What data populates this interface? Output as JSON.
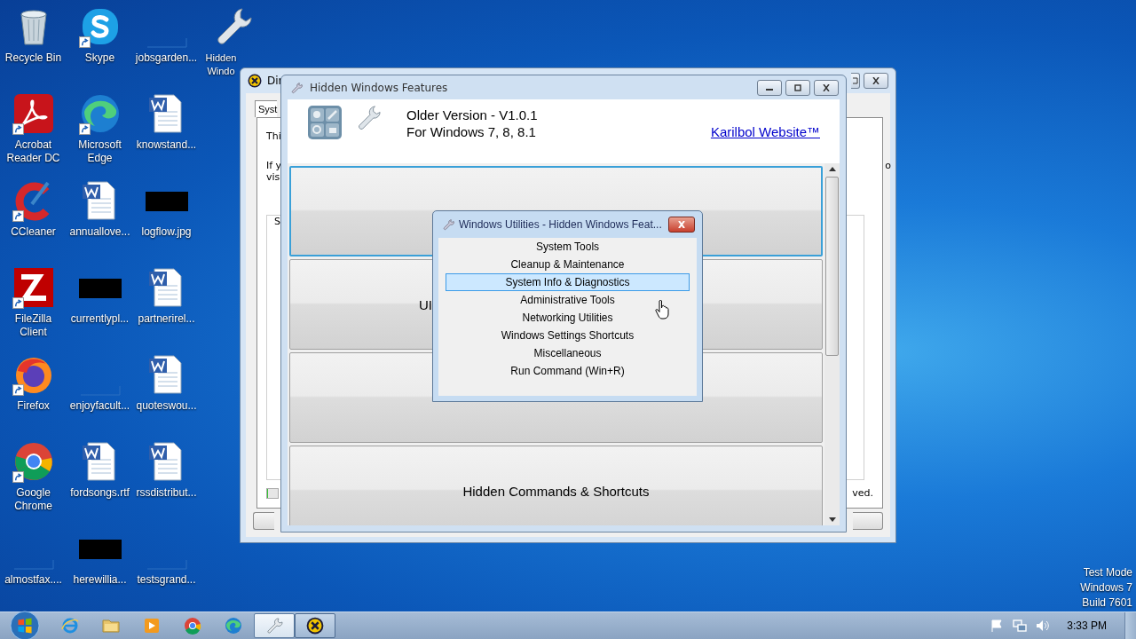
{
  "desktop": {
    "icon_columns": [
      [
        {
          "label": "Recycle Bin",
          "kind": "recycle",
          "shortcut": false
        },
        {
          "label": "Acrobat Reader DC",
          "kind": "acrobat",
          "shortcut": true
        },
        {
          "label": "CCleaner",
          "kind": "ccleaner",
          "shortcut": true
        },
        {
          "label": "FileZilla Client",
          "kind": "filezilla",
          "shortcut": true
        },
        {
          "label": "Firefox",
          "kind": "firefox",
          "shortcut": true
        },
        {
          "label": "Google Chrome",
          "kind": "chrome",
          "shortcut": true
        },
        {
          "label": "almostfax....",
          "kind": "blank",
          "shortcut": false
        }
      ],
      [
        {
          "label": "Skype",
          "kind": "skype",
          "shortcut": true
        },
        {
          "label": "Microsoft Edge",
          "kind": "edge",
          "shortcut": true
        },
        {
          "label": "annuallove...",
          "kind": "word",
          "shortcut": false
        },
        {
          "label": "currentlypl...",
          "kind": "black",
          "shortcut": false
        },
        {
          "label": "enjoyfacult...",
          "kind": "blank",
          "shortcut": false
        },
        {
          "label": "fordsongs.rtf",
          "kind": "word",
          "shortcut": false
        },
        {
          "label": "herewillia...",
          "kind": "black",
          "shortcut": false
        }
      ],
      [
        {
          "label": "jobsgarden...",
          "kind": "blank",
          "shortcut": false
        },
        {
          "label": "knowstand...",
          "kind": "word",
          "shortcut": false
        },
        {
          "label": "logflow.jpg",
          "kind": "black",
          "shortcut": false
        },
        {
          "label": "partnerirel...",
          "kind": "word",
          "shortcut": false
        },
        {
          "label": "quoteswou...",
          "kind": "word",
          "shortcut": false
        },
        {
          "label": "rssdistribut...",
          "kind": "word",
          "shortcut": false
        },
        {
          "label": "testsgrand...",
          "kind": "blank",
          "shortcut": false
        }
      ],
      [
        {
          "label": "Hidden Windo",
          "kind": "wrench",
          "shortcut": false
        }
      ]
    ],
    "watermark_lines": [
      "Test Mode",
      "Windows 7",
      "Build 7601"
    ]
  },
  "back_window": {
    "title": "Dir",
    "tab": "Syst",
    "texts": [
      "Thi",
      "If y",
      "vis",
      "S"
    ],
    "right_texts": [
      "o",
      "ved."
    ],
    "progress": {
      "level": 0.06
    }
  },
  "main_window": {
    "title": "Hidden Windows Features",
    "version": "Older Version - V1.0.1",
    "platforms": "For Windows 7, 8, 8.1",
    "link": "Karilbol Website™",
    "big_buttons": [
      {
        "selected": true
      },
      {
        "label": "UI",
        "selected": false
      },
      {
        "selected": false
      },
      {
        "label": "Hidden Commands & Shortcuts",
        "selected": false
      }
    ]
  },
  "popup": {
    "title": "Windows Utilities - Hidden Windows Feat...",
    "items": [
      {
        "label": "System Tools",
        "selected": false
      },
      {
        "label": "Cleanup & Maintenance",
        "selected": false
      },
      {
        "label": "System Info & Diagnostics",
        "selected": true
      },
      {
        "label": "Administrative Tools",
        "selected": false
      },
      {
        "label": "Networking Utilities",
        "selected": false
      },
      {
        "label": "Windows Settings Shortcuts",
        "selected": false
      },
      {
        "label": "Miscellaneous",
        "selected": false
      },
      {
        "label": "Run Command (Win+R)",
        "selected": false
      }
    ]
  },
  "taskbar": {
    "items": [
      {
        "kind": "ie",
        "active": false
      },
      {
        "kind": "folder",
        "active": false
      },
      {
        "kind": "media",
        "active": false
      },
      {
        "kind": "chrome",
        "active": false
      },
      {
        "kind": "edge",
        "active": false
      },
      {
        "kind": "wrench",
        "active": true
      },
      {
        "kind": "xapp",
        "active": false
      }
    ],
    "clock": "3:33 PM"
  }
}
